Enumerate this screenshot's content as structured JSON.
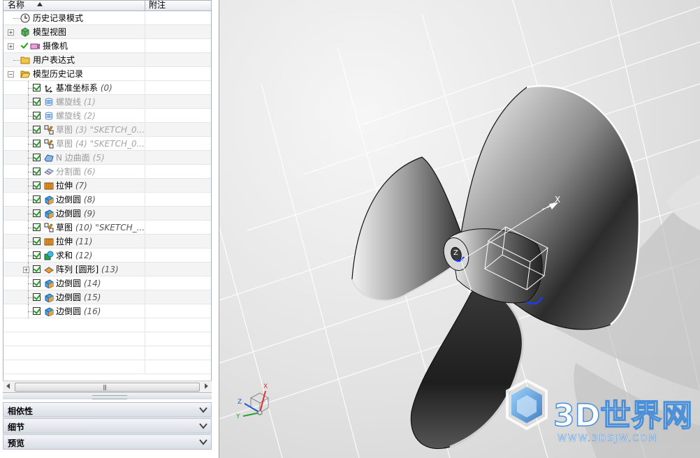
{
  "navigator": {
    "columns": {
      "name": "名称",
      "notes": "附注"
    },
    "rows": [
      {
        "label": "历史记录模式",
        "icon": "clock-icon",
        "number": ""
      },
      {
        "label": "模型视图",
        "icon": "model-views-icon",
        "number": ""
      },
      {
        "label": "摄像机",
        "icon": "camera-icon",
        "number": ""
      },
      {
        "label": "用户表达式",
        "icon": "folder-icon",
        "number": ""
      },
      {
        "label": "模型历史记录",
        "icon": "folder-open-icon",
        "number": ""
      },
      {
        "label": "基准坐标系",
        "icon": "datum-csys-icon",
        "number": "(0)"
      },
      {
        "label": "螺旋线",
        "icon": "helix-icon",
        "number": "(1)"
      },
      {
        "label": "螺旋线",
        "icon": "helix-icon",
        "number": "(2)"
      },
      {
        "label": "草图",
        "icon": "sketch-icon",
        "number": "(3) \"SKETCH_0..."
      },
      {
        "label": "草图",
        "icon": "sketch-icon",
        "number": "(4) \"SKETCH_0..."
      },
      {
        "label": "N 边曲面",
        "icon": "n-sided-surface-icon",
        "number": "(5)"
      },
      {
        "label": "分割面",
        "icon": "divide-face-icon",
        "number": "(6)"
      },
      {
        "label": "拉伸",
        "icon": "extrude-icon",
        "number": "(7)"
      },
      {
        "label": "边倒圆",
        "icon": "edge-blend-icon",
        "number": "(8)"
      },
      {
        "label": "边倒圆",
        "icon": "edge-blend-icon",
        "number": "(9)"
      },
      {
        "label": "草图",
        "icon": "sketch-icon",
        "number": "(10) \"SKETCH_..."
      },
      {
        "label": "拉伸",
        "icon": "extrude-icon",
        "number": "(11)"
      },
      {
        "label": "求和",
        "icon": "unite-icon",
        "number": "(12)"
      },
      {
        "label": "阵列 [圆形]",
        "icon": "pattern-icon",
        "number": "(13)"
      },
      {
        "label": "边倒圆",
        "icon": "edge-blend-icon",
        "number": "(14)"
      },
      {
        "label": "边倒圆",
        "icon": "edge-blend-icon",
        "number": "(15)"
      },
      {
        "label": "边倒圆",
        "icon": "edge-blend-icon",
        "number": "(16)"
      }
    ],
    "scroll_grip": "|||"
  },
  "panels": [
    {
      "label": "相依性"
    },
    {
      "label": "细节"
    },
    {
      "label": "预览"
    }
  ],
  "viewport": {
    "axis_labels": {
      "x": "X",
      "y": "Y",
      "z": "Z"
    },
    "triad_labels": {
      "x": "X",
      "y": "Y",
      "z": "Z"
    },
    "watermark": {
      "title": "3D世界网",
      "url": "WWW.3DSJW.COM"
    }
  },
  "colors": {
    "check_green": "#1ca01c",
    "watermark_blue": "#2a6fc0",
    "highlight_blue": "#1a3cff",
    "panel_border": "#9aa4b2"
  }
}
